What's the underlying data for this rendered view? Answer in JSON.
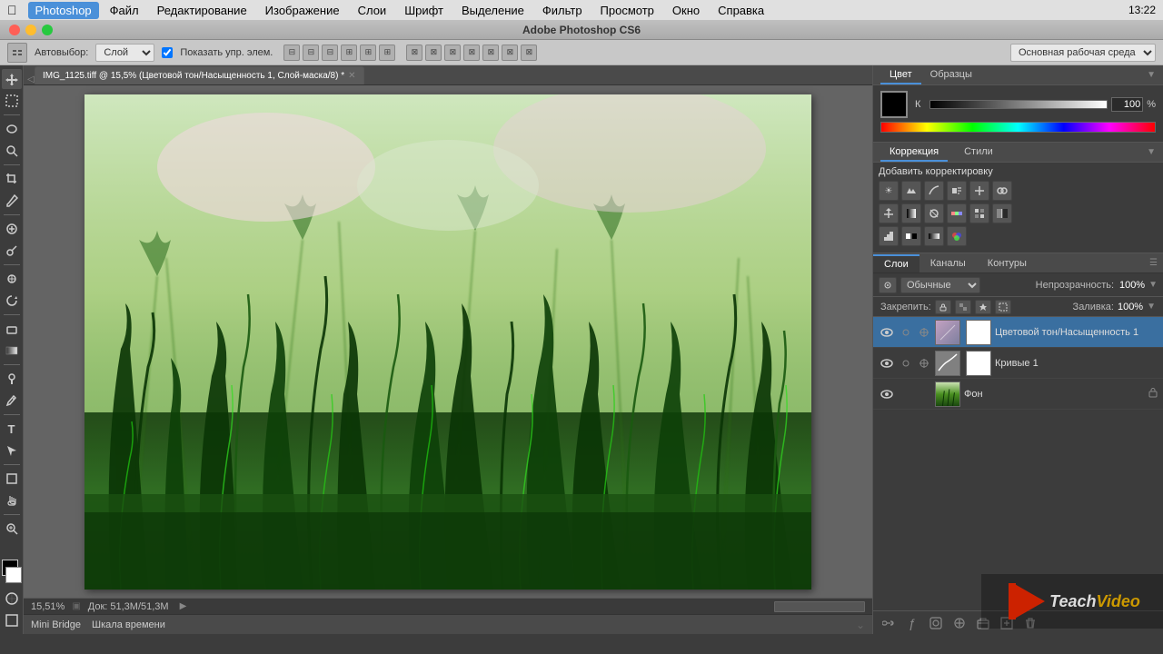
{
  "app": {
    "title": "Adobe Photoshop CS6",
    "name": "Photoshop"
  },
  "menubar": {
    "apple": "⌘",
    "items": [
      "Photoshop",
      "Файл",
      "Редактирование",
      "Изображение",
      "Слои",
      "Шрифт",
      "Выделение",
      "Фильтр",
      "Просмотр",
      "Окно",
      "Справка"
    ],
    "time": "13:22"
  },
  "options_bar": {
    "auto_label": "Автовыбор:",
    "auto_select": "Слой",
    "show_label": "Показать упр. элем.",
    "workspace_label": "Основная рабочая среда"
  },
  "document": {
    "tab_label": "IMG_1125.tiff @ 15,5% (Цветовой тон/Насыщенность 1, Слой-маска/8) *",
    "zoom": "15,51%",
    "doc_size": "Док: 51,3М/51,3М"
  },
  "color_panel": {
    "tabs": [
      "Цвет",
      "Образцы"
    ],
    "channel_label": "К",
    "value": "100",
    "percent": "%"
  },
  "correction_panel": {
    "tab_label": "Коррекция",
    "styles_label": "Стили",
    "add_label": "Добавить корректировку"
  },
  "layers_panel": {
    "tabs": [
      "Слои",
      "Каналы",
      "Контуры"
    ],
    "mode_label": "Обычные",
    "opacity_label": "Непрозрачность:",
    "opacity_value": "100%",
    "lock_label": "Закрепить:",
    "fill_label": "Заливка:",
    "fill_value": "100%",
    "layers": [
      {
        "name": "Цветовой тон/Насыщенность 1",
        "type": "hue",
        "visible": true,
        "active": true,
        "has_mask": true
      },
      {
        "name": "Кривые 1",
        "type": "curves",
        "visible": true,
        "active": false,
        "has_mask": true
      },
      {
        "name": "Фон",
        "type": "photo",
        "visible": true,
        "active": false,
        "has_mask": false,
        "locked": true
      }
    ]
  },
  "bottom_panel": {
    "mini_bridge": "Mini Bridge",
    "timeline": "Шкала времени"
  },
  "tools": {
    "move": "↖",
    "marquee": "□",
    "lasso": "◌",
    "quick_select": "✦",
    "crop": "⊡",
    "eyedropper": "✎",
    "spot_heal": "◉",
    "brush": "◉",
    "clone": "◎",
    "history_brush": "↩",
    "eraser": "⬜",
    "gradient": "▦",
    "dodge": "○",
    "pen": "✏",
    "text": "T",
    "path_select": "↗",
    "shape": "□",
    "hand": "✋",
    "zoom": "🔍"
  }
}
